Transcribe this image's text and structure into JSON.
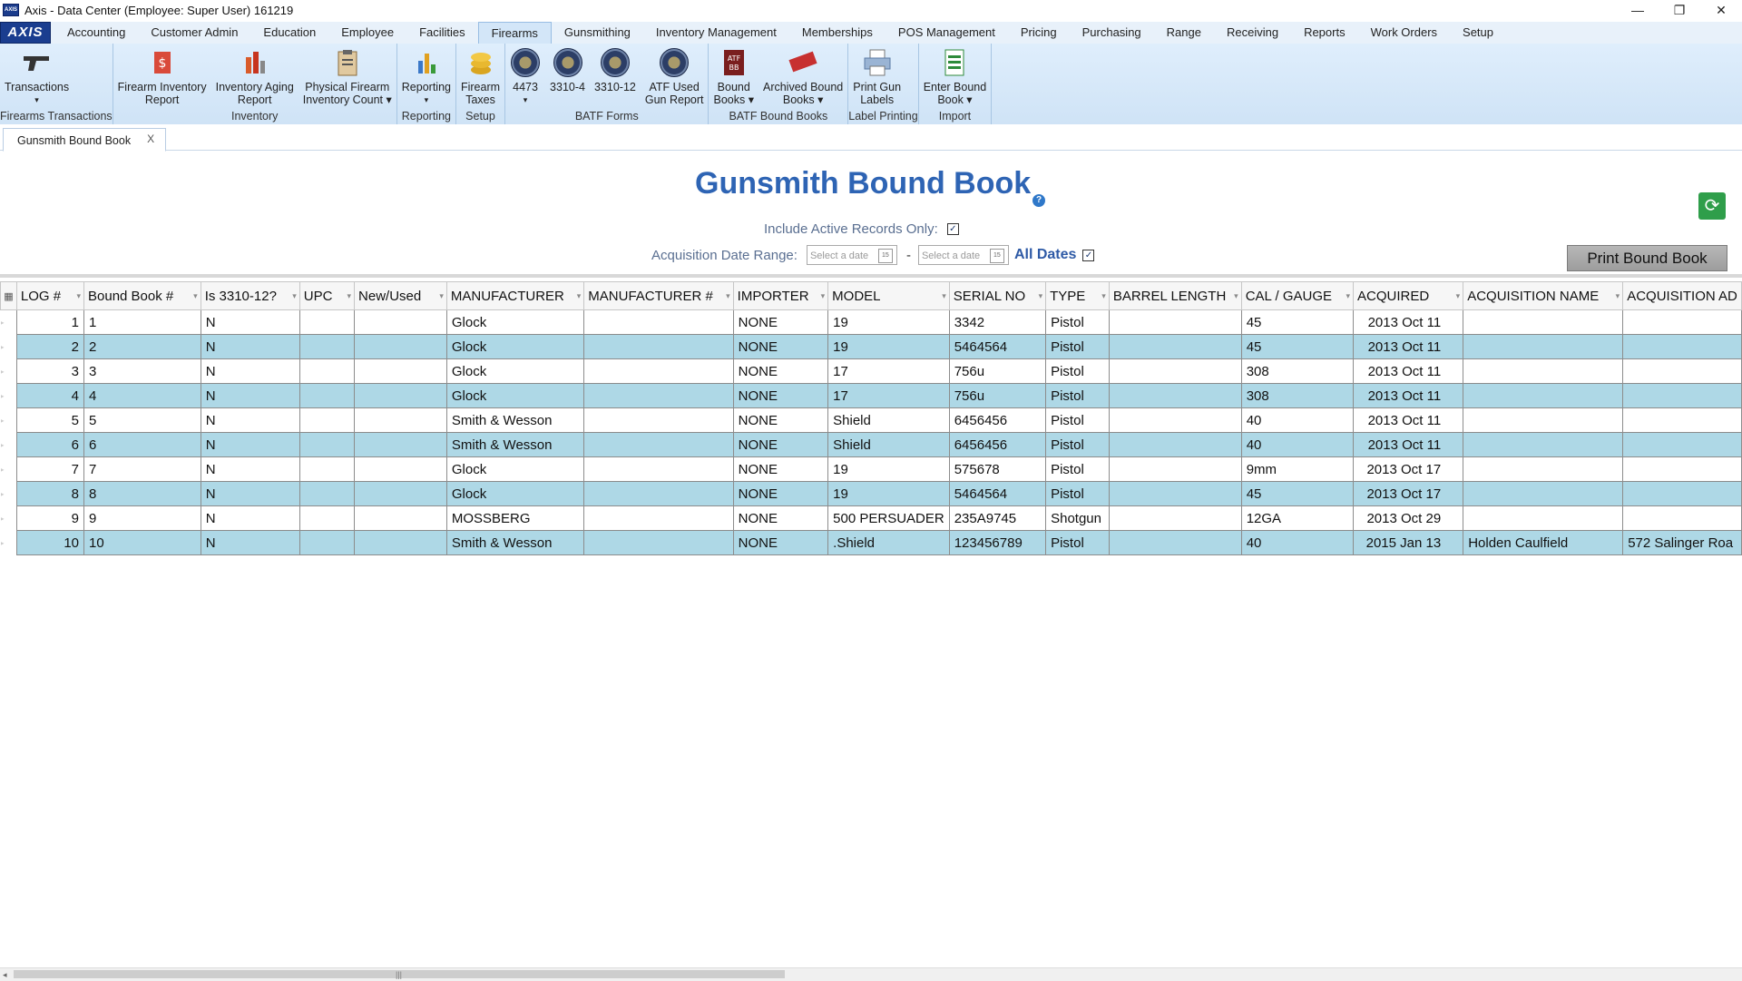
{
  "window": {
    "title": "Axis - Data Center  (Employee: Super User) 161219",
    "app_icon": "AXIS",
    "controls": [
      "—",
      "❐",
      "✕"
    ]
  },
  "menubar": {
    "logo": "AXIS",
    "tabs": [
      "Accounting",
      "Customer Admin",
      "Education",
      "Employee",
      "Facilities",
      "Firearms",
      "Gunsmithing",
      "Inventory Management",
      "Memberships",
      "POS Management",
      "Pricing",
      "Purchasing",
      "Range",
      "Receiving",
      "Reports",
      "Work Orders",
      "Setup"
    ],
    "active_tab": "Firearms"
  },
  "ribbon": {
    "groups": [
      {
        "label": "Firearms Transactions",
        "buttons": [
          {
            "label": "Transactions",
            "sub": "▾",
            "icon": "pistol-icon"
          }
        ]
      },
      {
        "label": "Inventory",
        "buttons": [
          {
            "label": "Firearm Inventory",
            "label2": "Report",
            "icon": "inventory-report-icon"
          },
          {
            "label": "Inventory Aging",
            "label2": "Report",
            "icon": "aging-report-icon"
          },
          {
            "label": "Physical Firearm",
            "label2": "Inventory Count ▾",
            "icon": "clipboard-icon"
          }
        ]
      },
      {
        "label": "Reporting",
        "buttons": [
          {
            "label": "Reporting",
            "sub": "▾",
            "icon": "bar-chart-icon"
          }
        ]
      },
      {
        "label": "Setup",
        "buttons": [
          {
            "label": "Firearm",
            "label2": "Taxes",
            "icon": "coins-icon"
          }
        ]
      },
      {
        "label": "BATF Forms",
        "buttons": [
          {
            "label": "4473",
            "sub": "▾",
            "icon": "atf-seal-icon"
          },
          {
            "label": "3310-4",
            "icon": "atf-seal-icon"
          },
          {
            "label": "3310-12",
            "icon": "atf-seal-icon"
          },
          {
            "label": "ATF Used",
            "label2": "Gun Report",
            "icon": "atf-seal-icon"
          }
        ]
      },
      {
        "label": "BATF Bound Books",
        "buttons": [
          {
            "label": "Bound",
            "label2": "Books ▾",
            "icon": "bound-book-icon"
          },
          {
            "label": "Archived Bound",
            "label2": "Books ▾",
            "icon": "archived-stamp-icon"
          }
        ]
      },
      {
        "label": "Label Printing",
        "buttons": [
          {
            "label": "Print Gun",
            "label2": "Labels",
            "icon": "printer-icon"
          }
        ]
      },
      {
        "label": "Import",
        "buttons": [
          {
            "label": "Enter Bound",
            "label2": "Book ▾",
            "icon": "import-sheet-icon"
          }
        ]
      }
    ]
  },
  "doc_tab": {
    "label": "Gunsmith Bound Book",
    "close": "X"
  },
  "page": {
    "title": "Gunsmith Bound Book",
    "help": "?",
    "include_active_label": "Include Active Records Only:",
    "include_active_checked": true,
    "date_range_label": "Acquisition Date Range:",
    "date_from_placeholder": "Select a date",
    "date_to_placeholder": "Select a date",
    "date_sep": "-",
    "all_dates_label": "All Dates",
    "all_dates_checked": true,
    "print_button": "Print Bound Book",
    "check_mark": "✓"
  },
  "grid": {
    "columns": [
      "LOG #",
      "Bound Book #",
      "Is 3310-12?",
      "UPC",
      "New/Used",
      "MANUFACTURER",
      "MANUFACTURER #",
      "IMPORTER",
      "MODEL",
      "SERIAL NO",
      "TYPE",
      "BARREL LENGTH",
      "CAL / GAUGE",
      "ACQUIRED",
      "ACQUISITION NAME",
      "ACQUISITION AD"
    ],
    "rows": [
      [
        "1",
        "1",
        "N",
        "",
        "",
        "Glock",
        "",
        "NONE",
        "19",
        "3342",
        "Pistol",
        "",
        "45",
        "2013 Oct 11",
        "",
        ""
      ],
      [
        "2",
        "2",
        "N",
        "",
        "",
        "Glock",
        "",
        "NONE",
        "19",
        "5464564",
        "Pistol",
        "",
        "45",
        "2013 Oct 11",
        "",
        ""
      ],
      [
        "3",
        "3",
        "N",
        "",
        "",
        "Glock",
        "",
        "NONE",
        "17",
        "756u",
        "Pistol",
        "",
        "308",
        "2013 Oct 11",
        "",
        ""
      ],
      [
        "4",
        "4",
        "N",
        "",
        "",
        "Glock",
        "",
        "NONE",
        "17",
        "756u",
        "Pistol",
        "",
        "308",
        "2013 Oct 11",
        "",
        ""
      ],
      [
        "5",
        "5",
        "N",
        "",
        "",
        "Smith & Wesson",
        "",
        "NONE",
        "Shield",
        "6456456",
        "Pistol",
        "",
        "40",
        "2013 Oct 11",
        "",
        ""
      ],
      [
        "6",
        "6",
        "N",
        "",
        "",
        "Smith & Wesson",
        "",
        "NONE",
        "Shield",
        "6456456",
        "Pistol",
        "",
        "40",
        "2013 Oct 11",
        "",
        ""
      ],
      [
        "7",
        "7",
        "N",
        "",
        "",
        "Glock",
        "",
        "NONE",
        "19",
        "575678",
        "Pistol",
        "",
        "9mm",
        "2013 Oct 17",
        "",
        ""
      ],
      [
        "8",
        "8",
        "N",
        "",
        "",
        "Glock",
        "",
        "NONE",
        "19",
        "5464564",
        "Pistol",
        "",
        "45",
        "2013 Oct 17",
        "",
        ""
      ],
      [
        "9",
        "9",
        "N",
        "",
        "",
        "MOSSBERG",
        "",
        "NONE",
        "500 PERSUADER",
        "235A9745",
        "Shotgun",
        "",
        "12GA",
        "2013 Oct 29",
        "",
        ""
      ],
      [
        "10",
        "10",
        "N",
        "",
        "",
        "Smith & Wesson",
        "",
        "NONE",
        ".Shield",
        "123456789",
        "Pistol",
        "",
        "40",
        "2015 Jan 13",
        "Holden Caulfield",
        "572 Salinger Roa"
      ]
    ]
  },
  "colors": {
    "title": "#2e64b4",
    "row_alt": "#aed8e6",
    "refresh": "#2f9e4a"
  }
}
